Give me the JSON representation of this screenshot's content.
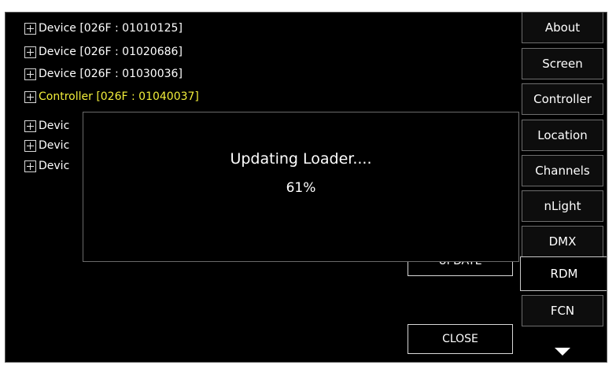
{
  "device_tree": {
    "items": [
      {
        "label": "Device [026F : 01010125]"
      },
      {
        "label": "Device [026F : 01020686]"
      },
      {
        "label": "Device [026F : 01030036]"
      },
      {
        "label": "Controller [026F : 01040037]"
      },
      {
        "label": "Devic"
      },
      {
        "label": "Devic"
      },
      {
        "label": "Devic"
      }
    ]
  },
  "tabs": [
    {
      "label": "About"
    },
    {
      "label": "Screen"
    },
    {
      "label": "Controller"
    },
    {
      "label": "Location"
    },
    {
      "label": "Channels"
    },
    {
      "label": "nLight"
    },
    {
      "label": "DMX"
    },
    {
      "label": "RDM"
    },
    {
      "label": "FCN"
    }
  ],
  "buttons": {
    "update_label": "UPDATE",
    "close_label": "CLOSE"
  },
  "modal": {
    "title": "Updating Loader....",
    "progress": "61%"
  },
  "colors": {
    "background": "#000000",
    "highlight": "#f2ee3a",
    "text": "#ffffff"
  }
}
